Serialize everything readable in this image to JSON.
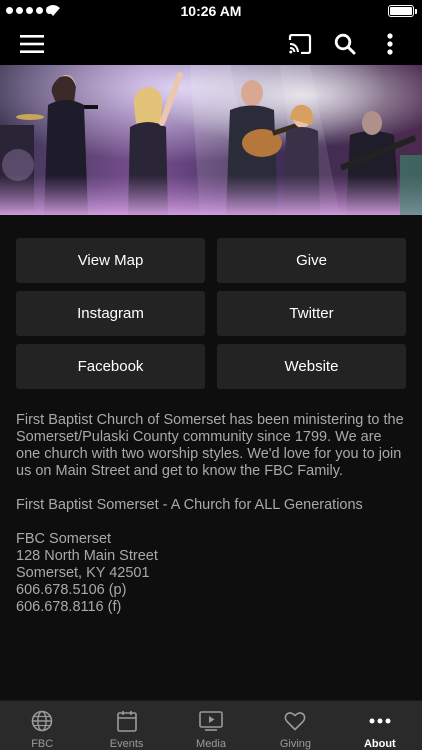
{
  "status_bar": {
    "time": "10:26 AM"
  },
  "navbar": {
    "icons": [
      "menu-icon",
      "cast-icon",
      "search-icon",
      "more-vertical-icon"
    ]
  },
  "links": [
    {
      "label": "View Map"
    },
    {
      "label": "Give"
    },
    {
      "label": "Instagram"
    },
    {
      "label": "Twitter"
    },
    {
      "label": "Facebook"
    },
    {
      "label": "Website"
    }
  ],
  "about": {
    "description": "First Baptist Church of Somerset has been ministering to the Somerset/Pulaski County community since 1799. We are one church with two worship styles. We'd love for you to join us on Main Street and get to know the FBC Family.",
    "tagline": "First Baptist Somerset - A Church for ALL Generations",
    "contact": {
      "name": "FBC Somerset",
      "street": "128 North Main Street",
      "city": "Somerset, KY 42501",
      "phone": "606.678.5106 (p)",
      "fax": "606.678.8116 (f)"
    }
  },
  "tabbar": {
    "tabs": [
      {
        "label": "FBC",
        "icon": "globe-icon"
      },
      {
        "label": "Events",
        "icon": "calendar-icon"
      },
      {
        "label": "Media",
        "icon": "play-screen-icon"
      },
      {
        "label": "Giving",
        "icon": "heart-icon"
      },
      {
        "label": "About",
        "icon": "more-horizontal-icon"
      }
    ],
    "active_tab": "About"
  },
  "colors": {
    "background": "#0e0e0e",
    "button_background": "#232323",
    "body_text": "#a9a9a9",
    "tabbar_background": "#2a2a2a"
  }
}
